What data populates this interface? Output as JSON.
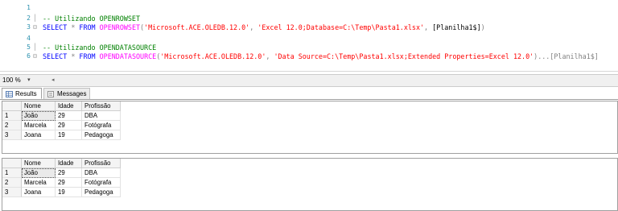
{
  "editor": {
    "lines": [
      {
        "num": "1",
        "segments": []
      },
      {
        "num": "2",
        "segments": [
          {
            "cls": "cm",
            "text": "-- Utilizando OPENROWSET"
          }
        ]
      },
      {
        "num": "3",
        "segments": [
          {
            "cls": "kw",
            "text": "SELECT"
          },
          {
            "cls": "tx",
            "text": " "
          },
          {
            "cls": "pun",
            "text": "*"
          },
          {
            "cls": "tx",
            "text": " "
          },
          {
            "cls": "kw",
            "text": "FROM"
          },
          {
            "cls": "tx",
            "text": " "
          },
          {
            "cls": "fn",
            "text": "OPENROWSET"
          },
          {
            "cls": "pun",
            "text": "("
          },
          {
            "cls": "str",
            "text": "'Microsoft.ACE.OLEDB.12.0'"
          },
          {
            "cls": "pun",
            "text": ","
          },
          {
            "cls": "tx",
            "text": " "
          },
          {
            "cls": "str",
            "text": "'Excel 12.0;Database=C:\\Temp\\Pasta1.xlsx'"
          },
          {
            "cls": "pun",
            "text": ","
          },
          {
            "cls": "tx",
            "text": " [Planilha1$]"
          },
          {
            "cls": "pun",
            "text": ")"
          }
        ]
      },
      {
        "num": "4",
        "segments": []
      },
      {
        "num": "5",
        "segments": [
          {
            "cls": "cm",
            "text": "-- Utilizando OPENDATASOURCE"
          }
        ]
      },
      {
        "num": "6",
        "segments": [
          {
            "cls": "kw",
            "text": "SELECT"
          },
          {
            "cls": "tx",
            "text": " "
          },
          {
            "cls": "pun",
            "text": "*"
          },
          {
            "cls": "tx",
            "text": " "
          },
          {
            "cls": "kw",
            "text": "FROM"
          },
          {
            "cls": "tx",
            "text": " "
          },
          {
            "cls": "fn",
            "text": "OPENDATASOURCE"
          },
          {
            "cls": "pun",
            "text": "("
          },
          {
            "cls": "str",
            "text": "'Microsoft.ACE.OLEDB.12.0'"
          },
          {
            "cls": "pun",
            "text": ","
          },
          {
            "cls": "tx",
            "text": " "
          },
          {
            "cls": "str",
            "text": "'Data Source=C:\\Temp\\Pasta1.xlsx;Extended Properties=Excel 12.0'"
          },
          {
            "cls": "pun",
            "text": ")...[Planilha1$]"
          }
        ]
      }
    ]
  },
  "zoom": {
    "value": "100 %"
  },
  "tabs": {
    "results": "Results",
    "messages": "Messages"
  },
  "grids": [
    {
      "columns": [
        "Nome",
        "Idade",
        "Profissão"
      ],
      "rows": [
        {
          "n": "1",
          "cells": [
            "João",
            "29",
            "DBA"
          ]
        },
        {
          "n": "2",
          "cells": [
            "Marcela",
            "29",
            "Fotógrafa"
          ]
        },
        {
          "n": "3",
          "cells": [
            "Joana",
            "19",
            "Pedagoga"
          ]
        }
      ]
    },
    {
      "columns": [
        "Nome",
        "Idade",
        "Profissão"
      ],
      "rows": [
        {
          "n": "1",
          "cells": [
            "João",
            "29",
            "DBA"
          ]
        },
        {
          "n": "2",
          "cells": [
            "Marcela",
            "29",
            "Fotógrafa"
          ]
        },
        {
          "n": "3",
          "cells": [
            "Joana",
            "19",
            "Pedagoga"
          ]
        }
      ]
    }
  ],
  "colors": {
    "keyword": "#0000ff",
    "comment": "#008000",
    "string": "#ff0000",
    "function": "#ff00ff",
    "line_number": "#2b91af"
  }
}
